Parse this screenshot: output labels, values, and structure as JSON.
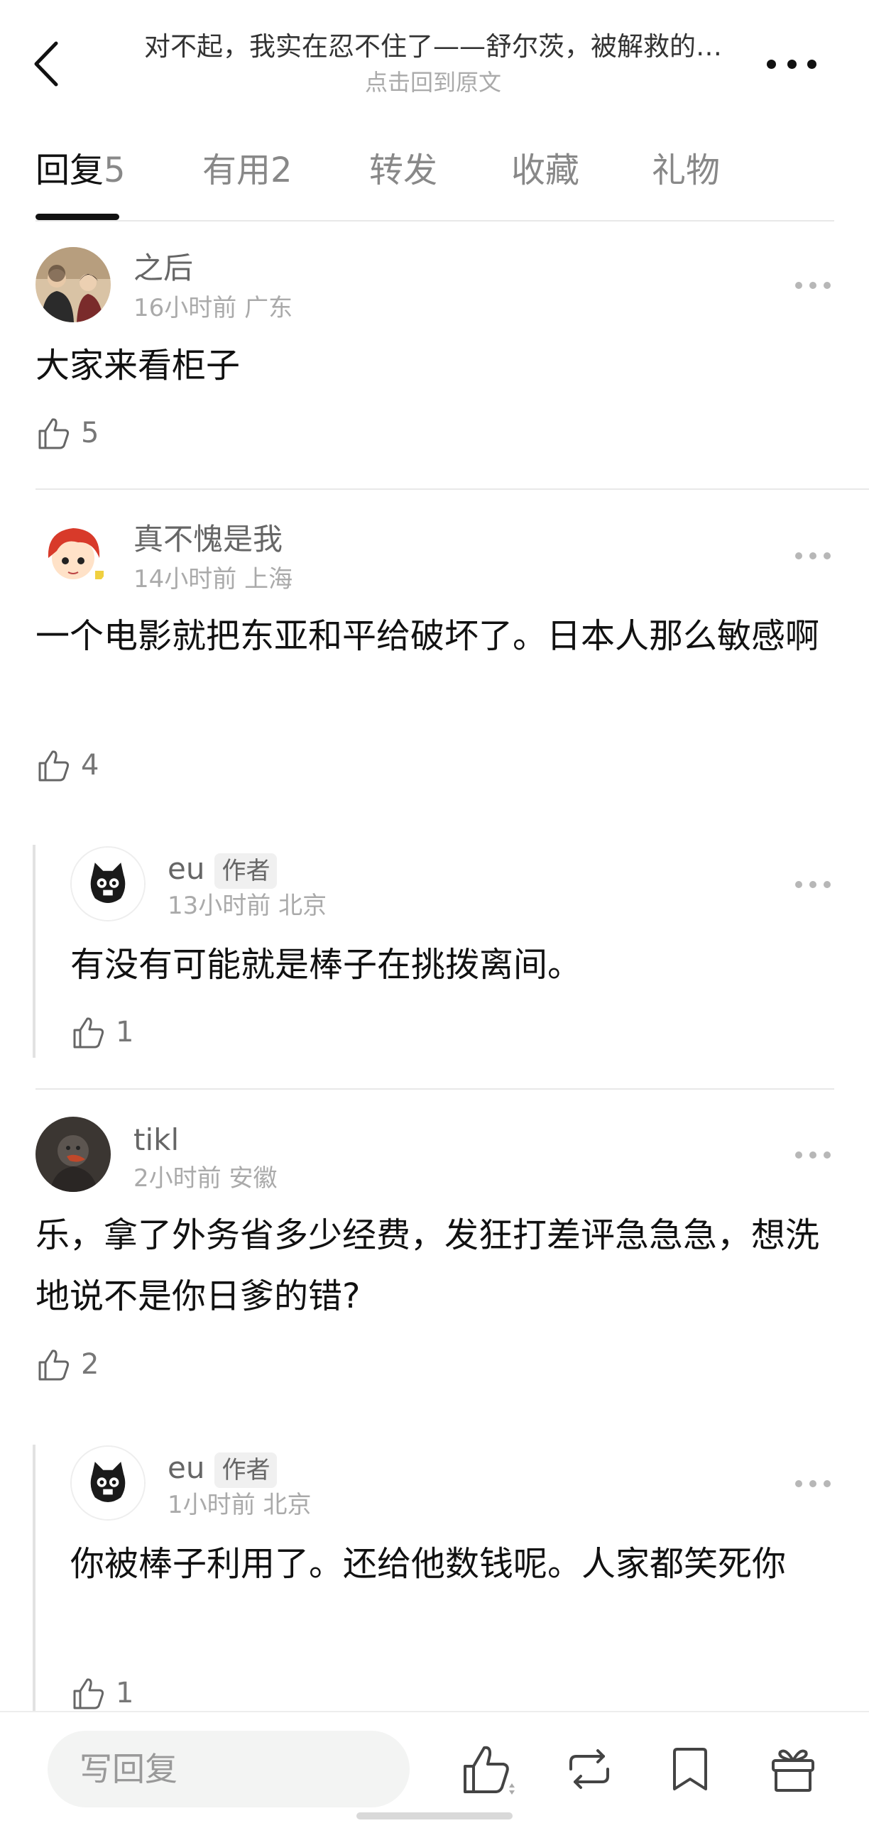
{
  "header": {
    "title": "对不起，我实在忍不住了——舒尔茨，被解救的…",
    "subtitle": "点击回到原文",
    "back_icon": "chevron-left-icon",
    "more_icon": "more-horizontal-icon"
  },
  "tabs": [
    {
      "label": "回复",
      "count": "5",
      "active": true
    },
    {
      "label": "有用",
      "count": "2",
      "active": false
    },
    {
      "label": "转发",
      "count": "",
      "active": false
    },
    {
      "label": "收藏",
      "count": "",
      "active": false
    },
    {
      "label": "礼物",
      "count": "",
      "active": false
    }
  ],
  "comments": [
    {
      "name": "之后",
      "time": "16小时前",
      "location": "广东",
      "text": "大家来看柜子",
      "likes": "5"
    },
    {
      "name": "真不愧是我",
      "time": "14小时前",
      "location": "上海",
      "text": "一个电影就把东亚和平给破坏了。日本人那么敏感啊",
      "likes": "4",
      "reply": {
        "name": "eu",
        "badge": "作者",
        "time": "13小时前",
        "location": "北京",
        "text": "有没有可能就是棒子在挑拨离间。",
        "likes": "1"
      }
    },
    {
      "name": "tikl",
      "time": "2小时前",
      "location": "安徽",
      "text": "乐，拿了外务省多少经费，发狂打差评急急急，想洗地说不是你日爹的错?",
      "likes": "2",
      "reply": {
        "name": "eu",
        "badge": "作者",
        "time": "1小时前",
        "location": "北京",
        "text": "你被棒子利用了。还给他数钱呢。人家都笑死你",
        "likes": "1"
      }
    }
  ],
  "bottom_bar": {
    "placeholder": "写回复",
    "icons": [
      "thumbs-up-icon",
      "repost-icon",
      "bookmark-icon",
      "gift-icon"
    ]
  },
  "colors": {
    "text": "#111111",
    "secondary": "#888888",
    "meta": "#aaaaaa",
    "divider": "#e8e8e8"
  }
}
